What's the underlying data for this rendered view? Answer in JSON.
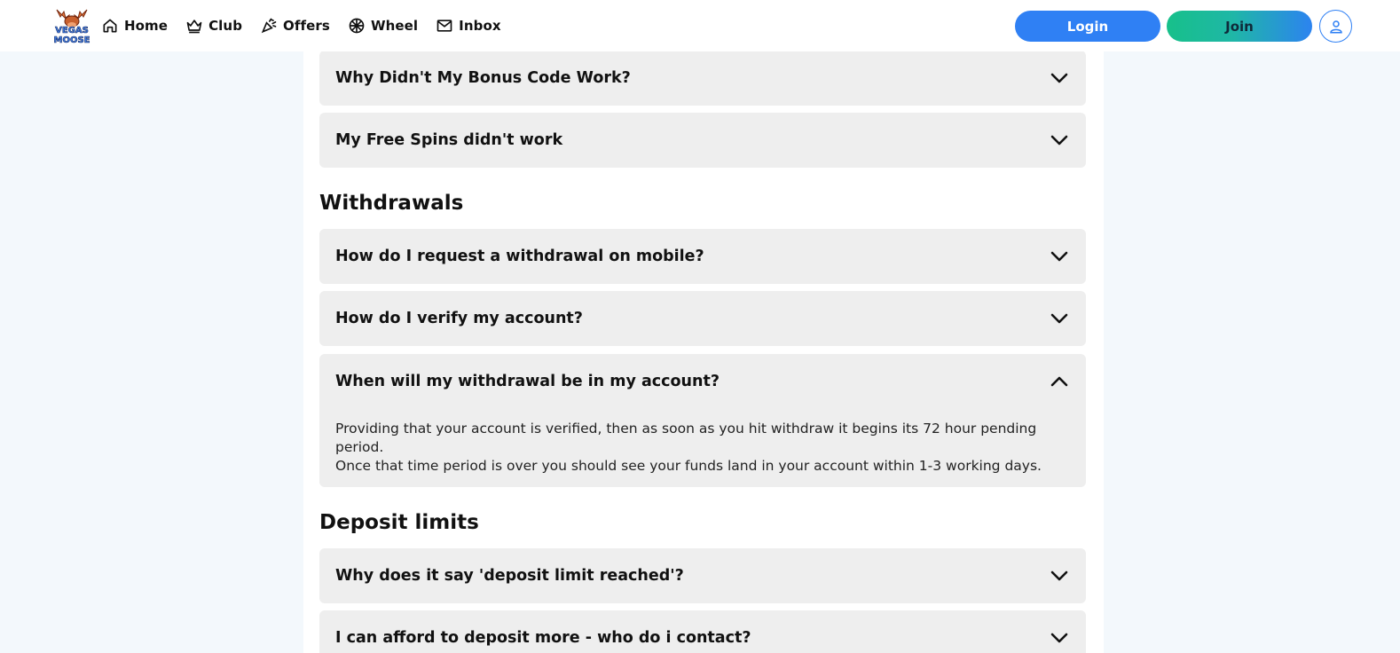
{
  "header": {
    "logo_text": "VEGAS MOOSE",
    "nav": [
      {
        "label": "Home",
        "icon": "home-icon"
      },
      {
        "label": "Club",
        "icon": "crown-icon"
      },
      {
        "label": "Offers",
        "icon": "party-popper-icon"
      },
      {
        "label": "Wheel",
        "icon": "wheel-icon"
      },
      {
        "label": "Inbox",
        "icon": "envelope-icon"
      }
    ],
    "login_label": "Login",
    "join_label": "Join",
    "account_icon": "user-icon",
    "colors": {
      "login": "#2f80f4",
      "join_start": "#17c08a",
      "join_end": "#2c83f0"
    }
  },
  "faqs_top": [
    {
      "question": "Why Didn't My Bonus Code Work?",
      "expanded": false
    },
    {
      "question": "My Free Spins didn't work",
      "expanded": false
    }
  ],
  "withdrawals": {
    "title": "Withdrawals",
    "items": [
      {
        "question": "How do I request a withdrawal on mobile?",
        "expanded": false
      },
      {
        "question": "How do I verify my account?",
        "expanded": false
      },
      {
        "question": "When will my withdrawal be in my account?",
        "expanded": true,
        "answer_line1": "Providing that your account is verified, then as soon as you hit withdraw it begins its 72 hour pending period.",
        "answer_line2": "Once that time period is over you should see your funds land in your account within 1-3 working days."
      }
    ]
  },
  "deposit_limits": {
    "title": "Deposit limits",
    "items": [
      {
        "question": "Why does it say 'deposit limit reached'?",
        "expanded": false
      },
      {
        "question": "I can afford to deposit more - who do i contact?",
        "expanded": false
      }
    ]
  }
}
